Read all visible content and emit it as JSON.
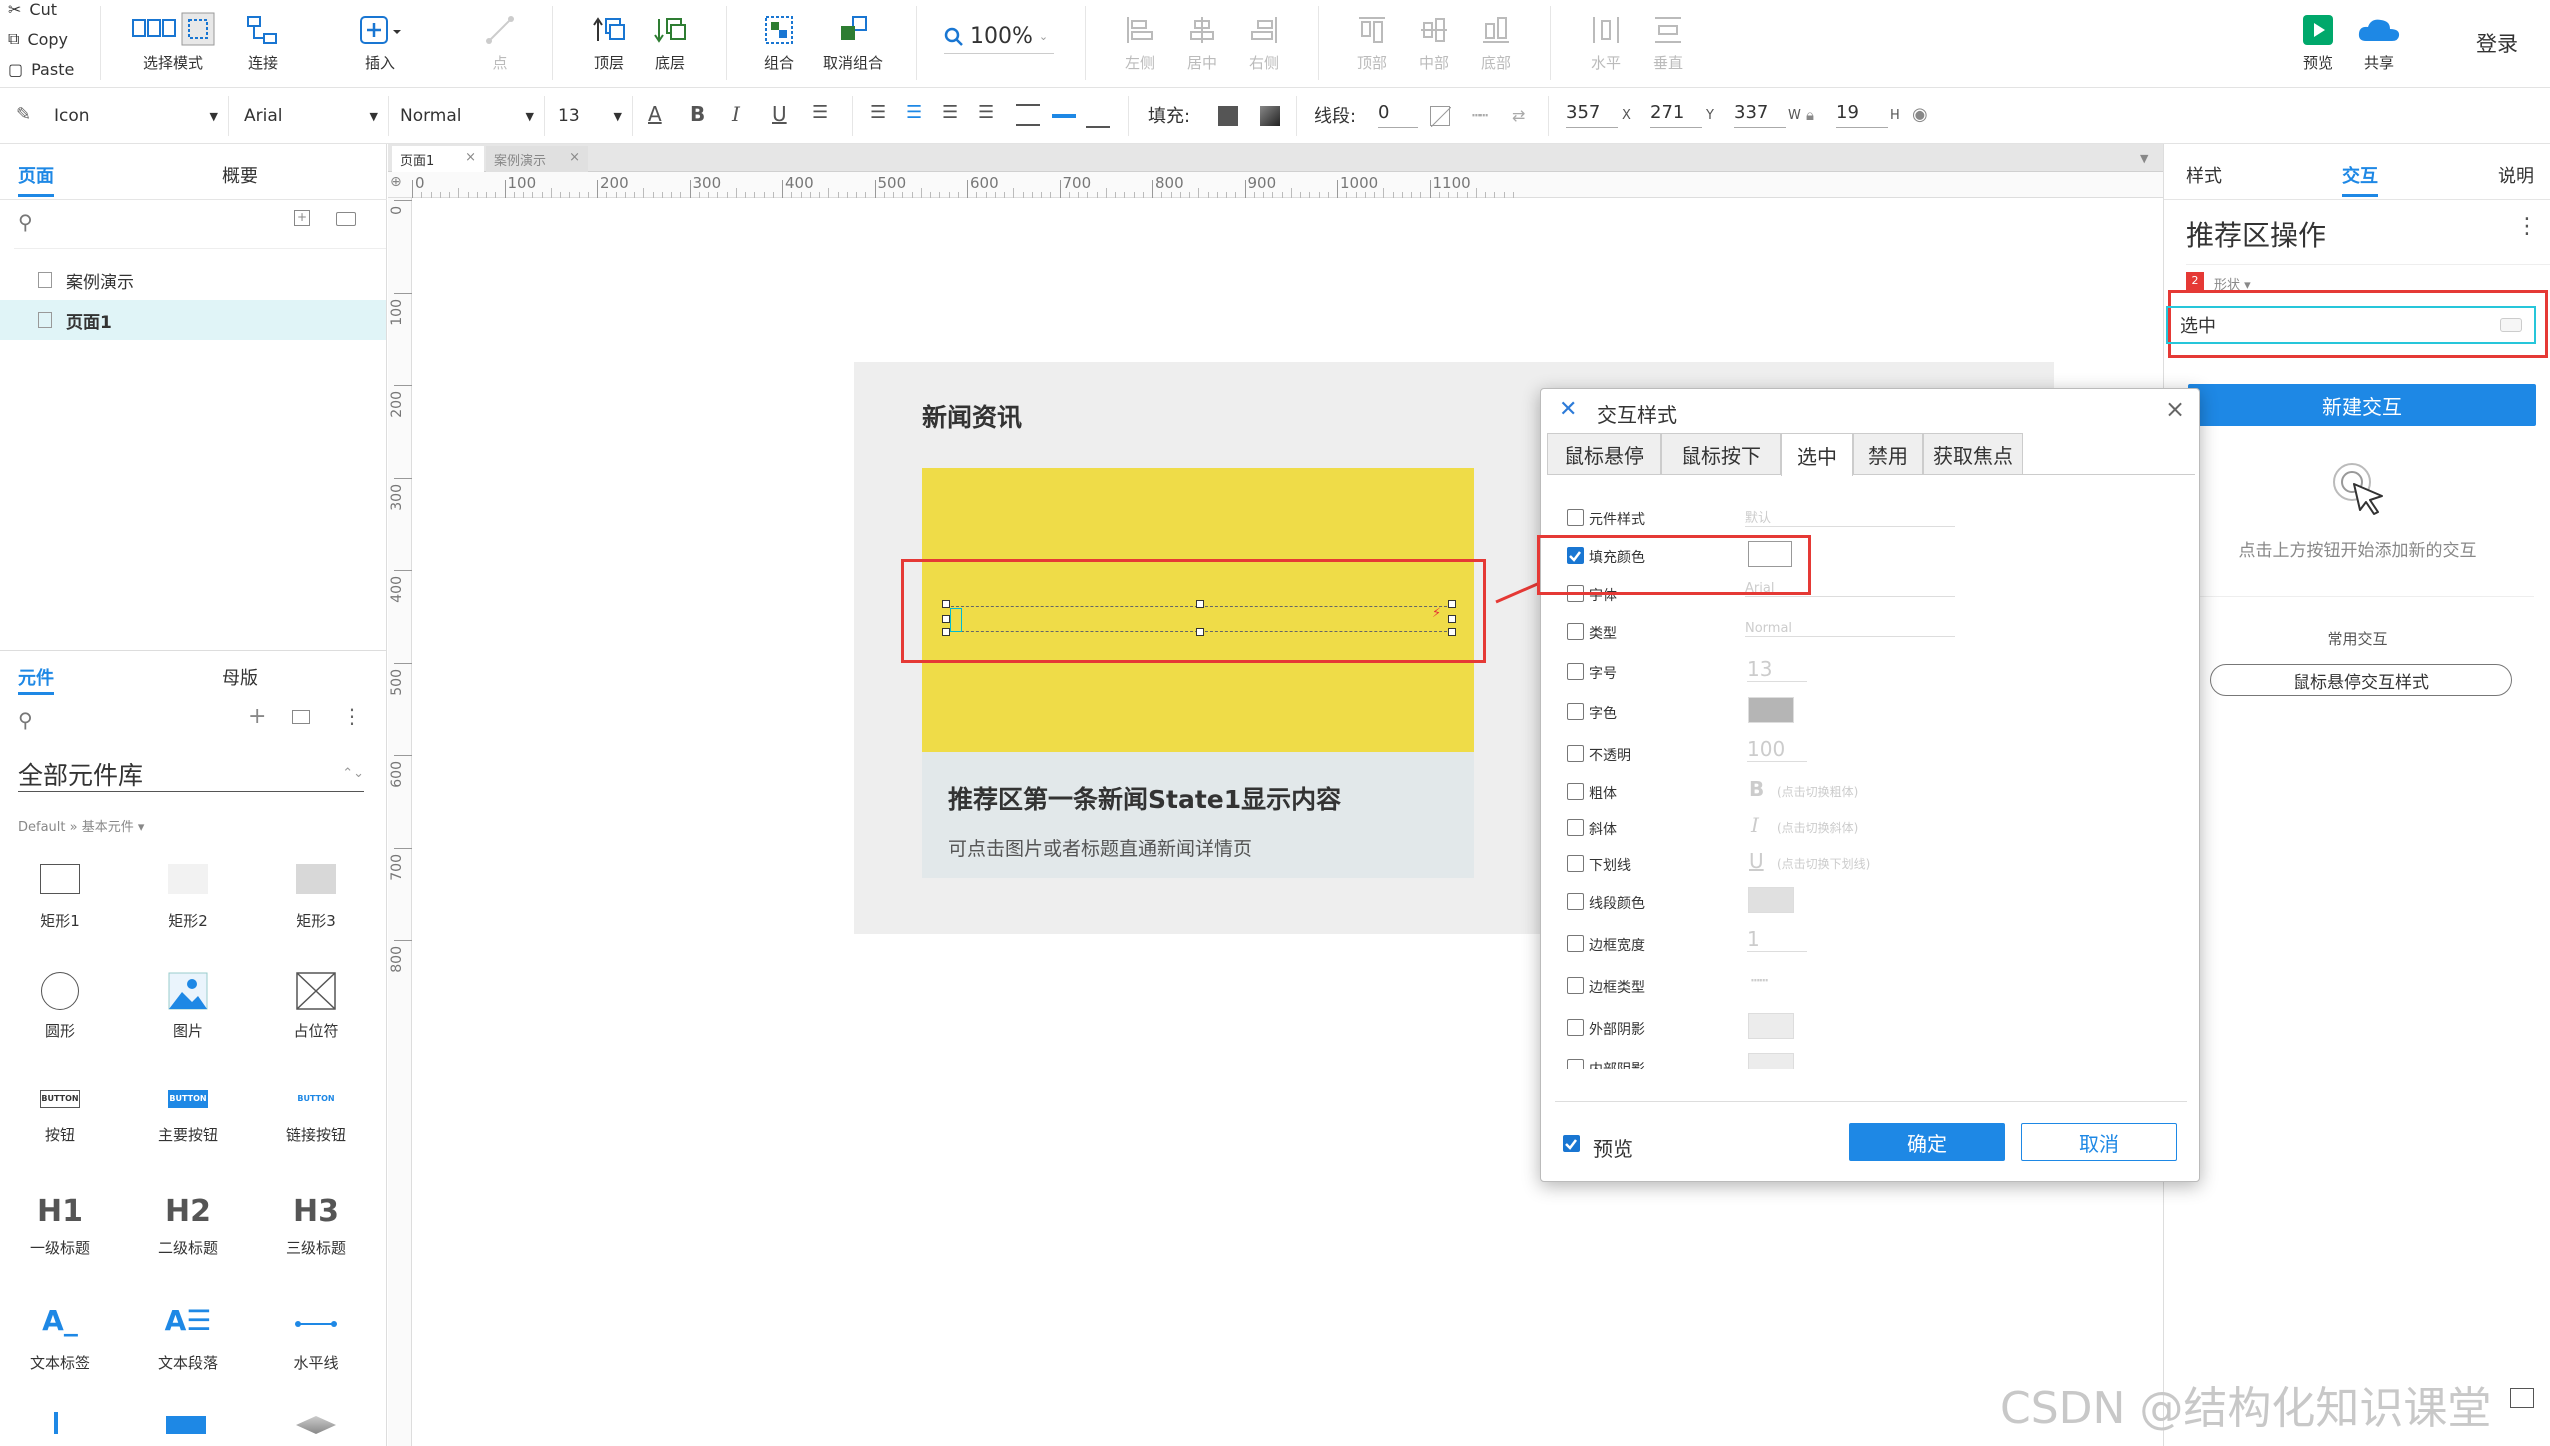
{
  "clipboard": {
    "cut": "Cut",
    "copy": "Copy",
    "paste": "Paste"
  },
  "toolbar": {
    "select_mode": "选择模式",
    "connect": "连接",
    "insert": "插入",
    "point": "点",
    "top_layer": "顶层",
    "bottom_layer": "底层",
    "group": "组合",
    "ungroup": "取消组合",
    "zoom": "100%",
    "align_left": "左侧",
    "align_center": "居中",
    "align_right": "右侧",
    "align_top": "顶部",
    "align_middle": "中部",
    "align_bottom": "底部",
    "dist_h": "水平",
    "dist_v": "垂直",
    "preview": "预览",
    "share": "共享",
    "login": "登录"
  },
  "format": {
    "style_name": "Icon",
    "font": "Arial",
    "weight": "Normal",
    "size": "13",
    "fill_label": "填充:",
    "stroke_label": "线段:",
    "stroke_value": "0",
    "x": "357",
    "x_unit": "X",
    "y": "271",
    "y_unit": "Y",
    "w": "337",
    "w_unit": "W",
    "h": "19",
    "h_unit": "H"
  },
  "left": {
    "tab_pages": "页面",
    "tab_outline": "概要",
    "pages": [
      {
        "name": "案例演示"
      },
      {
        "name": "页面1"
      }
    ],
    "tab_widgets": "元件",
    "tab_masters": "母版",
    "library": "全部元件库",
    "lib_path": "Default » 基本元件 ▾",
    "widgets": [
      {
        "name": "矩形1"
      },
      {
        "name": "矩形2"
      },
      {
        "name": "矩形3"
      },
      {
        "name": "圆形"
      },
      {
        "name": "图片"
      },
      {
        "name": "占位符"
      },
      {
        "name": "按钮"
      },
      {
        "name": "主要按钮"
      },
      {
        "name": "链接按钮"
      },
      {
        "name": "一级标题"
      },
      {
        "name": "二级标题"
      },
      {
        "name": "三级标题"
      },
      {
        "name": "文本标签"
      },
      {
        "name": "文本段落"
      },
      {
        "name": "水平线"
      }
    ],
    "btn_text": "BUTTON",
    "h1": "H1",
    "h2": "H2",
    "h3": "H3"
  },
  "doc_tabs": [
    {
      "name": "页面1"
    },
    {
      "name": "案例演示"
    }
  ],
  "ruler_h": [
    "0",
    "100",
    "200",
    "300",
    "400",
    "500",
    "600",
    "700",
    "800",
    "900",
    "1000",
    "1100"
  ],
  "ruler_v": [
    "0",
    "100",
    "200",
    "300",
    "400",
    "500",
    "600",
    "700",
    "800"
  ],
  "page": {
    "section_title": "新闻资讯",
    "news_title": "推荐区第一条新闻State1显示内容",
    "news_desc": "可点击图片或者标题直通新闻详情页"
  },
  "right": {
    "tab_style": "样式",
    "tab_interact": "交互",
    "tab_notes": "说明",
    "widget_name": "推荐区操作",
    "shape_badge": "2",
    "shape_label": "形状 ▾",
    "state_value": "选中",
    "new_interaction": "新建交互",
    "hint": "点击上方按钮开始添加新的交互",
    "common_label": "常用交互",
    "hover_style_btn": "鼠标悬停交互样式"
  },
  "dialog": {
    "title": "交互样式",
    "tabs": [
      {
        "name": "鼠标悬停"
      },
      {
        "name": "鼠标按下"
      },
      {
        "name": "选中"
      },
      {
        "name": "禁用"
      },
      {
        "name": "获取焦点"
      }
    ],
    "props": [
      {
        "label": "元件样式",
        "value": "默认"
      },
      {
        "label": "填充颜色",
        "value": ""
      },
      {
        "label": "字体",
        "value": "Arial"
      },
      {
        "label": "类型",
        "value": "Normal"
      },
      {
        "label": "字号",
        "value": "13"
      },
      {
        "label": "字色",
        "value": ""
      },
      {
        "label": "不透明",
        "value": "100"
      },
      {
        "label": "粗体",
        "value": "(点击切换粗体)"
      },
      {
        "label": "斜体",
        "value": "(点击切换斜体)"
      },
      {
        "label": "下划线",
        "value": "(点击切换下划线)"
      },
      {
        "label": "线段颜色",
        "value": ""
      },
      {
        "label": "边框宽度",
        "value": "1"
      },
      {
        "label": "边框类型",
        "value": ""
      },
      {
        "label": "外部阴影",
        "value": ""
      },
      {
        "label": "内部阴影",
        "value": ""
      }
    ],
    "glyph_bold": "B",
    "glyph_italic": "I",
    "glyph_underline": "U",
    "preview_label": "预览",
    "ok": "确定",
    "cancel": "取消"
  },
  "watermark": "CSDN @结构化知识课堂",
  "colors": {
    "accent": "#1e88e5",
    "highlight": "#e53935",
    "yellow": "#efdc48"
  }
}
